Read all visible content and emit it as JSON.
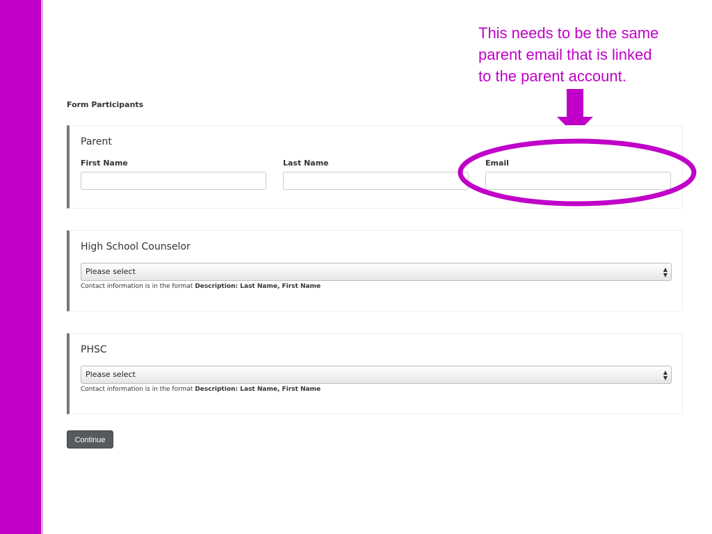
{
  "annotation": {
    "lines": [
      "This needs to be the same",
      "parent email that is linked",
      "to the parent account."
    ],
    "color": "#c000c8"
  },
  "form": {
    "title": "Form Participants",
    "parent": {
      "heading": "Parent",
      "first_name_label": "First Name",
      "last_name_label": "Last Name",
      "email_label": "Email",
      "first_name_value": "",
      "last_name_value": "",
      "email_value": ""
    },
    "counselor": {
      "heading": "High School Counselor",
      "selected": "Please select",
      "help_prefix": "Contact information is in the format ",
      "help_format": "Description: Last Name, First Name"
    },
    "phsc": {
      "heading": "PHSC",
      "selected": "Please select",
      "help_prefix": "Contact information is in the format ",
      "help_format": "Description: Last Name, First Name"
    },
    "continue_label": "Continue"
  },
  "icons": {
    "annotation_arrow": "down-arrow-icon",
    "annotation_circle": "highlight-ellipse-icon",
    "select_arrows": "updown-chevron-icon"
  },
  "colors": {
    "accent": "#c000c8",
    "panel_border": "#777777",
    "button_bg": "#555b5e"
  }
}
